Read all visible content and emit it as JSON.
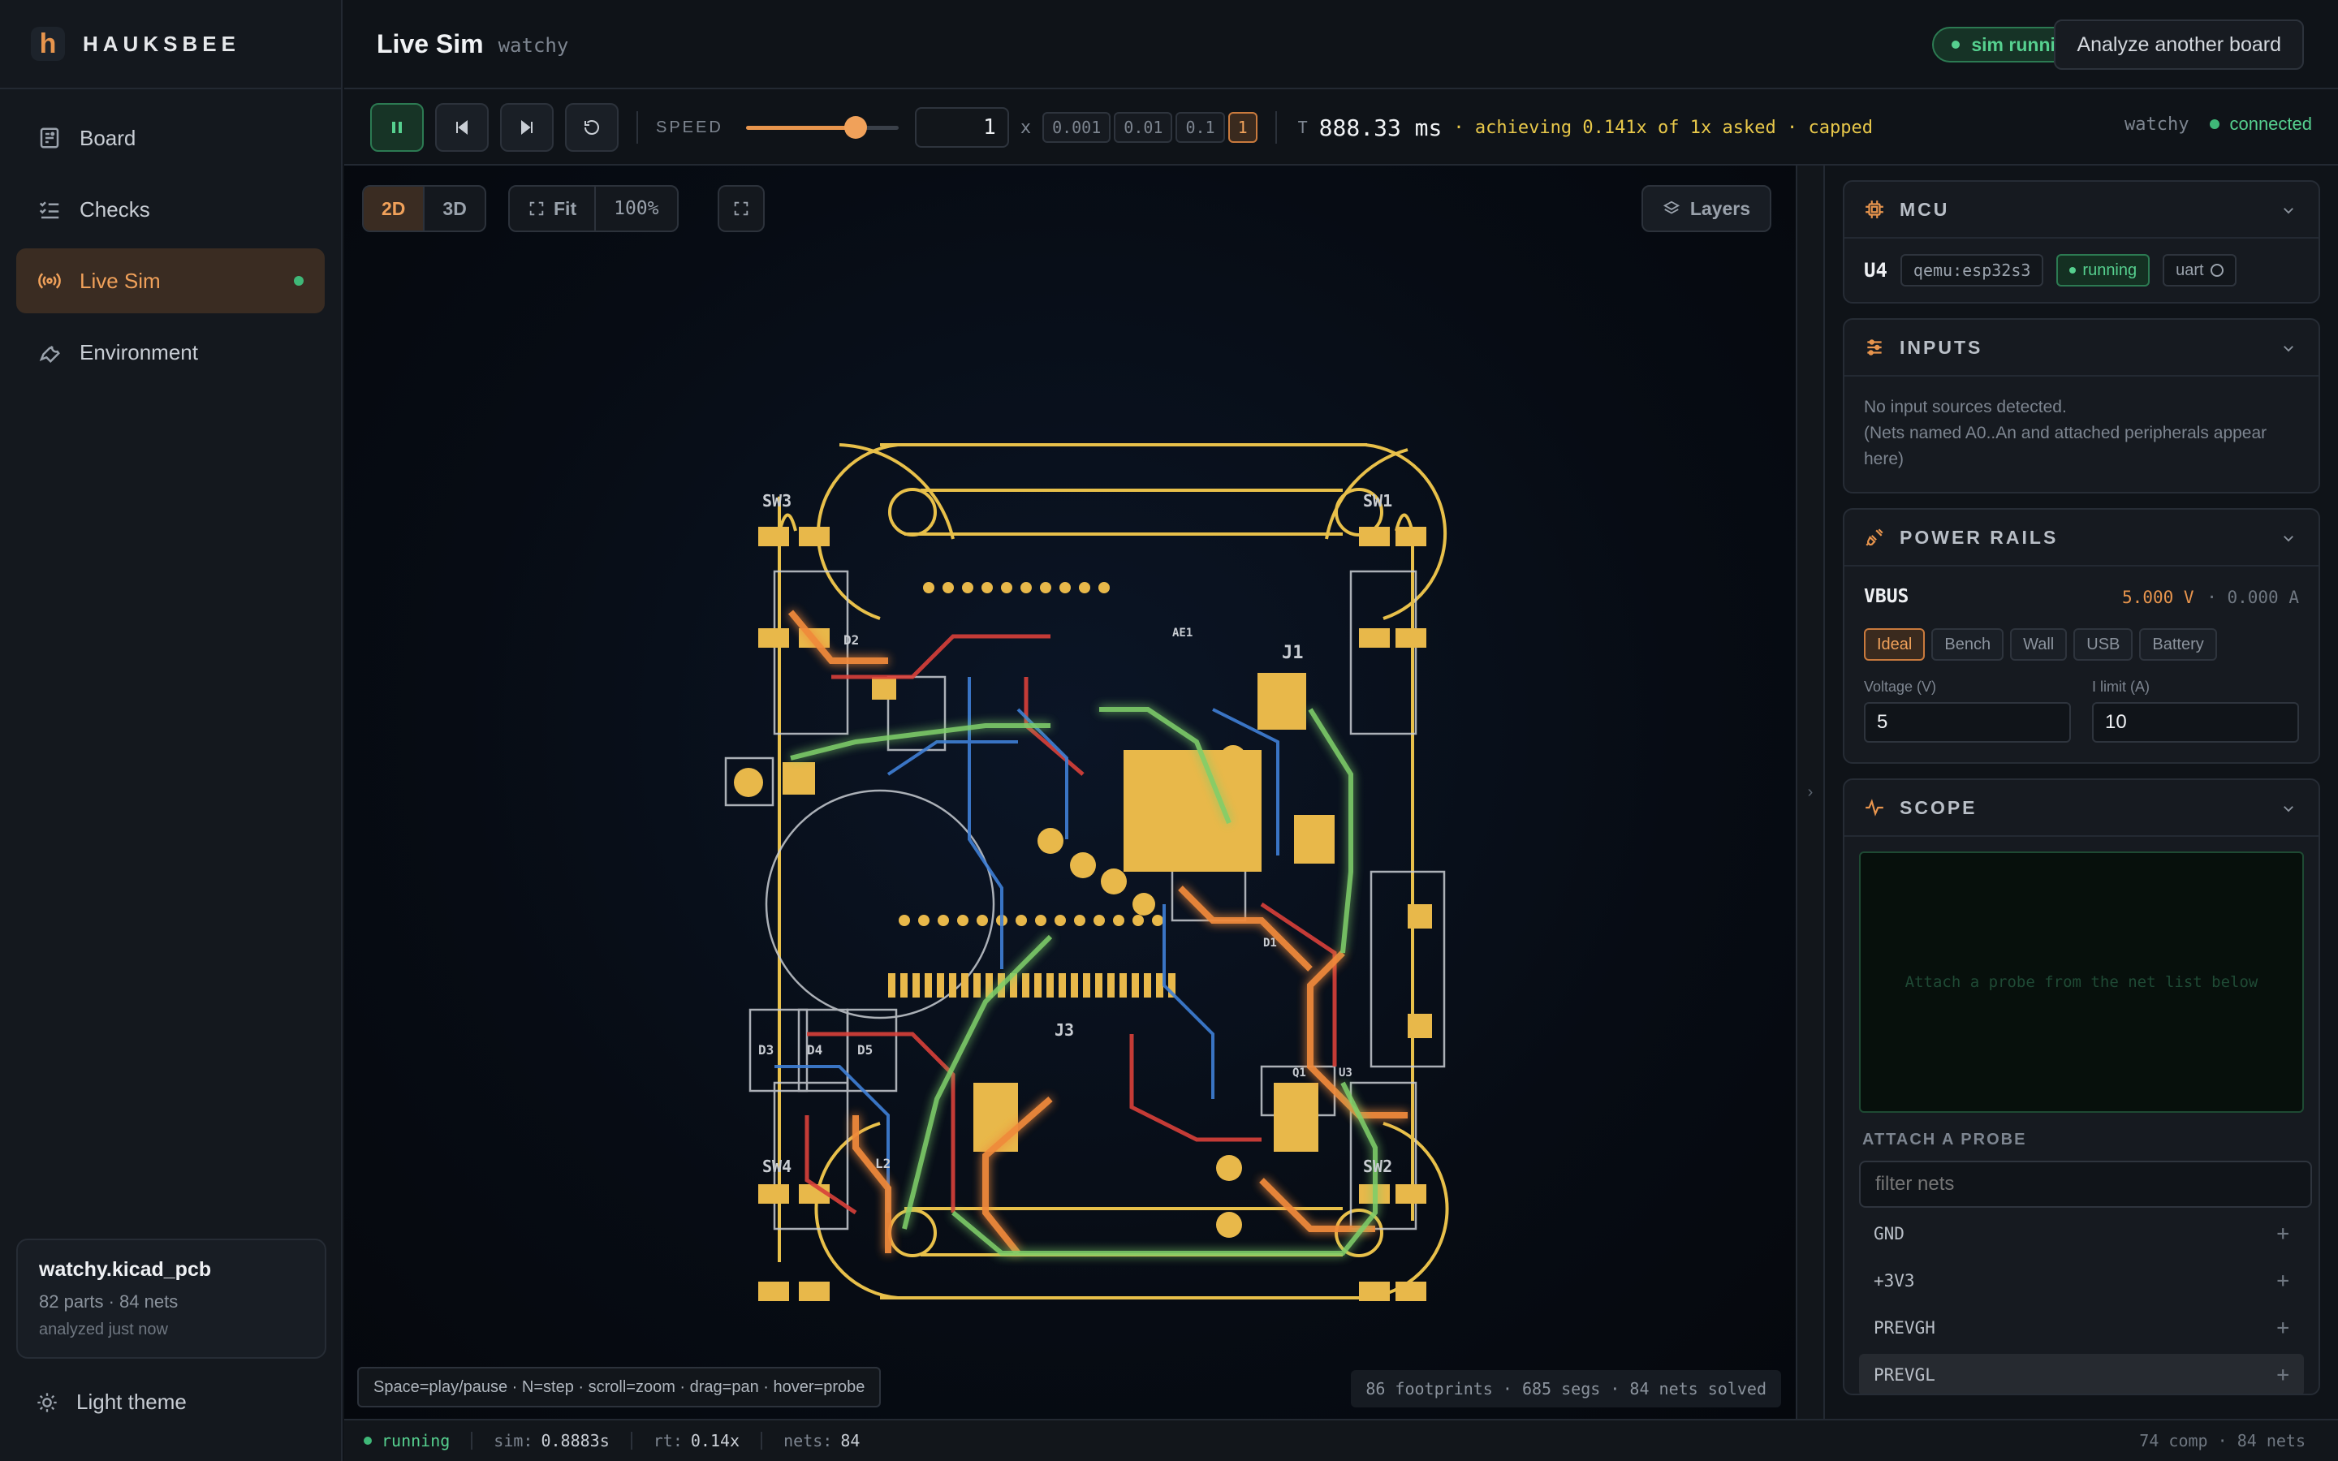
{
  "app": {
    "name": "HAUKSBEE",
    "logo_letter": "h"
  },
  "nav": [
    {
      "id": "board",
      "label": "Board",
      "icon": "board-icon"
    },
    {
      "id": "checks",
      "label": "Checks",
      "icon": "checklist-icon"
    },
    {
      "id": "live-sim",
      "label": "Live Sim",
      "icon": "broadcast-icon",
      "active": true,
      "status": "live"
    },
    {
      "id": "environment",
      "label": "Environment",
      "icon": "wrench-icon"
    }
  ],
  "file": {
    "name": "watchy.kicad_pcb",
    "meta": "82 parts · 84 nets",
    "analyzed": "analyzed just now"
  },
  "theme_toggle": {
    "label": "Light theme",
    "icon": "sun-icon"
  },
  "header": {
    "title": "Live Sim",
    "subtitle": "watchy",
    "badge": "sim running",
    "analyze_button": "Analyze another board"
  },
  "toolbar": {
    "speed_label": "SPEED",
    "speed_value": "1",
    "speed_fraction": 0.72,
    "multiplier": "x",
    "presets": [
      "0.001",
      "0.01",
      "0.1",
      "1"
    ],
    "active_preset": "1",
    "time_label": "T",
    "time_value": "888.33 ms",
    "time_note": "· achieving 0.141x of 1x asked · capped",
    "device": "watchy",
    "connection": "connected"
  },
  "canvas": {
    "view_2d": "2D",
    "view_3d": "3D",
    "fit_label": "Fit",
    "zoom": "100%",
    "layers_label": "Layers",
    "hint": "Space=play/pause · N=step · scroll=zoom · drag=pan · hover=probe",
    "stats": "86 footprints · 685 segs · 84 nets solved",
    "ref_labels": {
      "sw3": "SW3",
      "sw1": "SW1",
      "sw4": "SW4",
      "sw2": "SW2",
      "j1": "J1",
      "j3": "J3",
      "d2": "D2",
      "d3": "D3",
      "d4": "D4",
      "d5": "D5",
      "ae1": "AE1",
      "q1": "Q1",
      "u3": "U3",
      "d1": "D1",
      "l2": "L2"
    }
  },
  "panel": {
    "mcu": {
      "title": "MCU",
      "ref": "U4",
      "target": "qemu:esp32s3",
      "state": "running",
      "uart": "uart"
    },
    "inputs": {
      "title": "INPUTS",
      "line1": "No input sources detected.",
      "line2": "(Nets named A0..An and attached peripherals appear here)"
    },
    "power": {
      "title": "POWER RAILS",
      "rail": "VBUS",
      "voltage_readout": "5.000 V",
      "current_readout": "· 0.000 A",
      "modes": [
        "Ideal",
        "Bench",
        "Wall",
        "USB",
        "Battery"
      ],
      "active_mode": "Ideal",
      "voltage_label": "Voltage (V)",
      "voltage_value": "5",
      "limit_label": "I limit (A)",
      "limit_value": "10"
    },
    "scope": {
      "title": "SCOPE",
      "placeholder": "Attach a probe from the net list below",
      "probe_label": "ATTACH A PROBE",
      "filter_placeholder": "filter nets",
      "nets": [
        "GND",
        "+3V3",
        "PREVGH",
        "PREVGL"
      ],
      "plus": "+"
    }
  },
  "status": {
    "state": "running",
    "sim_label": "sim:",
    "sim_value": "0.8883s",
    "rt_label": "rt:",
    "rt_value": "0.14x",
    "nets_label": "nets:",
    "nets_value": "84",
    "summary": "74 comp · 84 nets"
  },
  "colors": {
    "accent": "#e8954d",
    "running": "#56d08f",
    "copper": "#e8b84a",
    "trace_red": "#d9403a",
    "trace_blue": "#3f7fd6",
    "trace_orange": "#f08a3a",
    "trace_green": "#7fcf6a",
    "silk": "#c8ccd2"
  }
}
